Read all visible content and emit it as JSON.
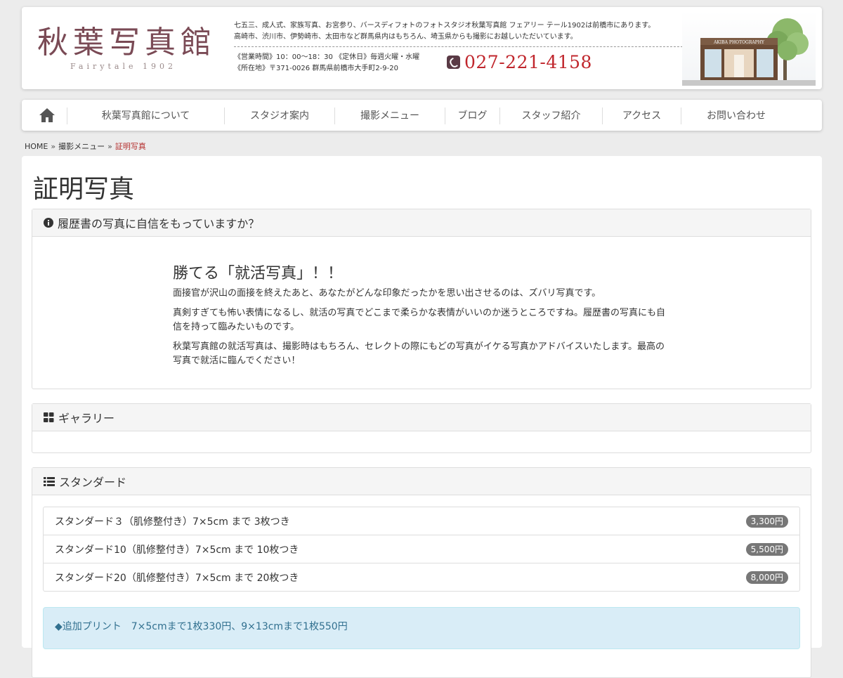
{
  "header": {
    "logo_main": "秋葉写真館",
    "logo_sub": "Fairytale 1902",
    "intro_line1": "七五三、成人式、家族写真、お宮参り、バースディフォトのフォトスタジオ秋葉写真館 フェアリー テール1902は前橋市にあります。",
    "intro_line2": "高崎市、渋川市、伊勢崎市、太田市など群馬県内はもちろん、埼玉県からも撮影にお越しいただいています。",
    "hours": "《営業時間》10：00〜18：30 《定休日》毎週火曜・水曜",
    "address": "《所在地》〒371-0026 群馬県前橋市大手町2-9-20",
    "phone": "027-221-4158",
    "shop_sign": "AKIBA PHOTOGRAPHY"
  },
  "nav": {
    "items": [
      {
        "label": "秋葉写真館について"
      },
      {
        "label": "スタジオ案内"
      },
      {
        "label": "撮影メニュー"
      },
      {
        "label": "ブログ"
      },
      {
        "label": "スタッフ紹介"
      },
      {
        "label": "アクセス"
      },
      {
        "label": "お問い合わせ"
      }
    ]
  },
  "breadcrumb": {
    "home": "HOME",
    "menu": "撮影メニュー",
    "current": "証明写真"
  },
  "page": {
    "title": "証明写真",
    "panel1": {
      "heading": "履歴書の写真に自信をもっていますか？",
      "lead_title": "勝てる「就活写真」！！",
      "p1": "面接官が沢山の面接を終えたあと、あなたがどんな印象だったかを思い出させるのは、ズバリ写真です。",
      "p2": "真剣すぎても怖い表情になるし、就活の写真でどこまで柔らかな表情がいいのか迷うところですね。履歴書の写真にも自信を持って臨みたいものです。",
      "p3": "秋葉写真館の就活写真は、撮影時はもちろん、セレクトの際にもどの写真がイケる写真かアドバイスいたします。最高の写真で就活に臨んでください！"
    },
    "panel2": {
      "heading": "ギャラリー"
    },
    "panel3": {
      "heading": "スタンダード",
      "items": [
        {
          "label": "スタンダード３（肌修整付き）7×5cm まで 3枚つき",
          "price": "3,300円"
        },
        {
          "label": "スタンダード10（肌修整付き）7×5cm まで 10枚つき",
          "price": "5,500円"
        },
        {
          "label": "スタンダード20（肌修整付き）7×5cm まで 20枚つき",
          "price": "8,000円"
        }
      ],
      "note": "◆追加プリント　7×5cmまで1枚330円、9×13cmまで1枚550円"
    }
  },
  "colors": {
    "logo": "#7a4a55",
    "phone": "#c0262c",
    "breadcrumb_current": "#b5302f",
    "alert_bg": "#d9edf7",
    "badge": "#777777"
  }
}
